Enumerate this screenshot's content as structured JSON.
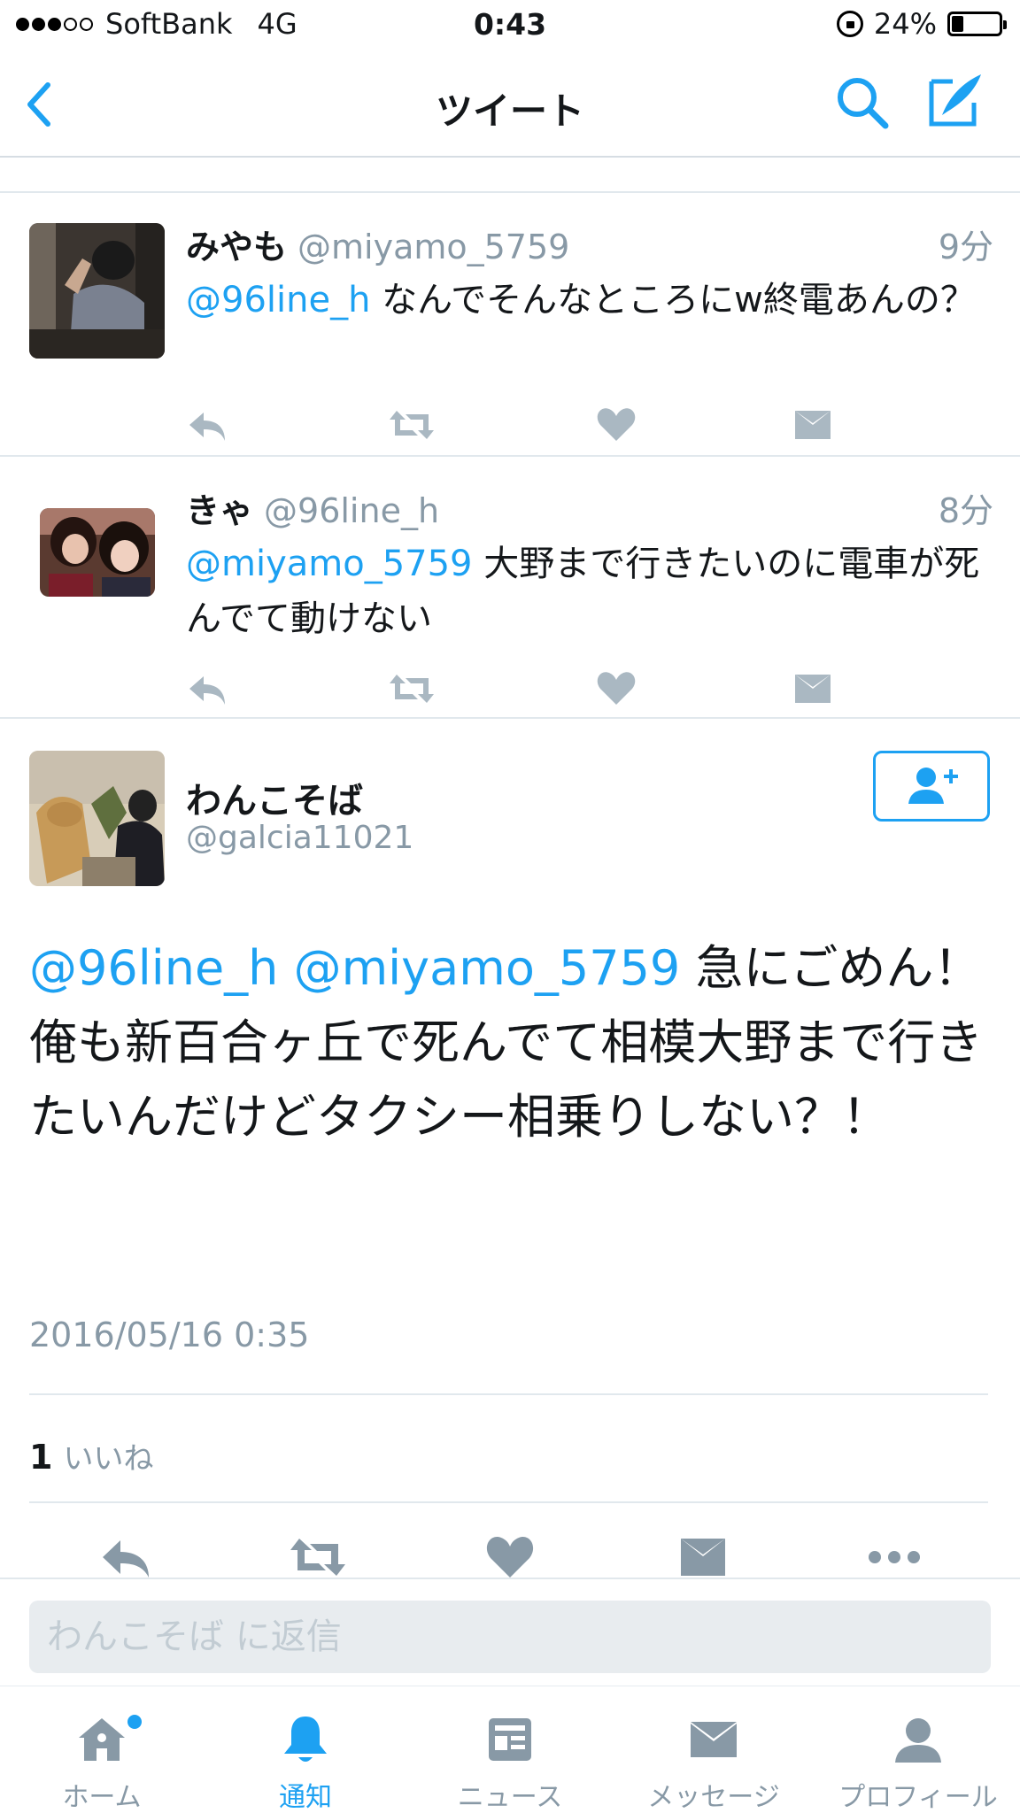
{
  "status_bar": {
    "carrier": "SoftBank",
    "network": "4G",
    "time": "0:43",
    "battery": "24%",
    "battery_level": 0.24
  },
  "nav": {
    "title": "ツイート"
  },
  "tweets": [
    {
      "name": "みやも",
      "handle": "@miyamo_5759",
      "time": "9分",
      "mention": "@96line_h",
      "text": " なんでそんなところにw終電あんの？"
    },
    {
      "name": "きゃ",
      "handle": "@96line_h",
      "time": "8分",
      "mention": "@miyamo_5759",
      "text": " 大野まで行きたいのに電車が死んでて動けない"
    }
  ],
  "main_tweet": {
    "name": "わんこそば",
    "handle": "@galcia11021",
    "mention1": "@96line_h",
    "mention2": "@miyamo_5759",
    "line1": " 急にごめん！",
    "line2": "俺も新百合ヶ丘で死んでて相模大野まで行きたいんだけどタクシー相乗りしない？！",
    "date": "2016/05/16 0:35",
    "like_count": "1",
    "like_label": "いいね"
  },
  "reply": {
    "placeholder": "わんこそば に返信"
  },
  "tabs": [
    {
      "label": "ホーム"
    },
    {
      "label": "通知"
    },
    {
      "label": "ニュース"
    },
    {
      "label": "メッセージ"
    },
    {
      "label": "プロフィール"
    }
  ],
  "colors": {
    "accent": "#1da1f2",
    "gray": "#8899a6",
    "action_gray": "#aab8c2"
  }
}
